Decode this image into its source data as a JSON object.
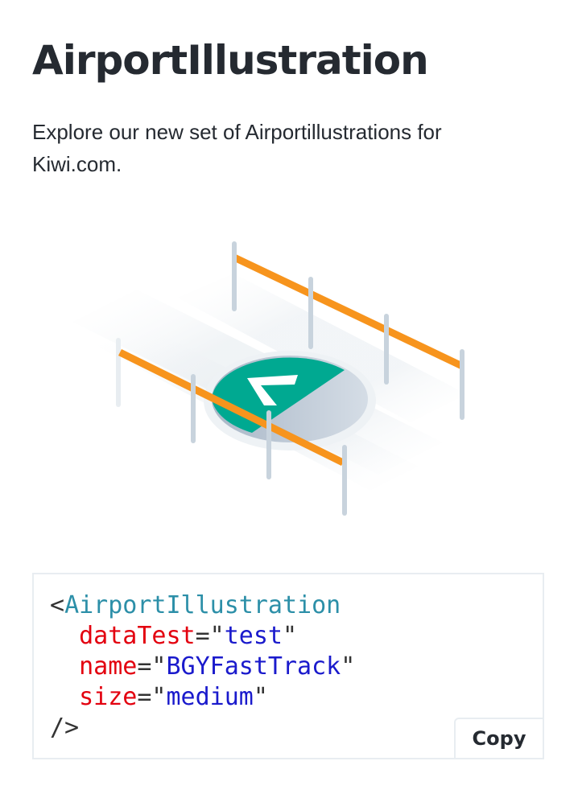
{
  "page": {
    "title": "AirportIllustration",
    "description": "Explore our new set of Airportillustrations for Kiwi.com."
  },
  "illustration": {
    "name": "BGYFastTrack",
    "icon": "fast-track-lane-illustration",
    "colors": {
      "rope": "#f7941d",
      "post": "#c8d3dd",
      "disc_green": "#00a991",
      "disc_gray": "#bac7d5",
      "lane_shadow": "#e8edf1"
    }
  },
  "code": {
    "lt": "<",
    "component": "AirportIllustration",
    "attributes": [
      {
        "name": "dataTest",
        "eq": "=\"",
        "value": "test",
        "close": "\""
      },
      {
        "name": "name",
        "eq": "=\"",
        "value": "BGYFastTrack",
        "close": "\""
      },
      {
        "name": "size",
        "eq": "=\"",
        "value": "medium",
        "close": "\""
      }
    ],
    "closing": "/>"
  },
  "copy_button": {
    "label": "Copy"
  }
}
